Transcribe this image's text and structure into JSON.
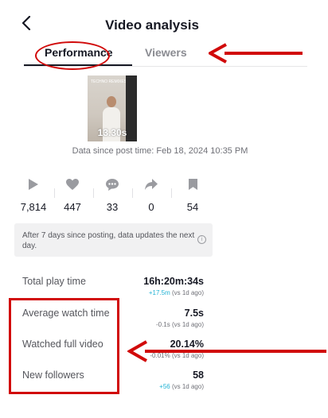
{
  "header": {
    "back_icon": "chevron-left-icon",
    "title": "Video analysis"
  },
  "tabs": [
    {
      "label": "Performance",
      "active": true
    },
    {
      "label": "Viewers",
      "active": false
    }
  ],
  "video": {
    "duration": "13.30s",
    "caption": "TECHNO REMIXES >"
  },
  "data_since": "Data since post time: Feb 18, 2024 10:35 PM",
  "stats": [
    {
      "icon": "play-icon",
      "value": "7,814"
    },
    {
      "icon": "heart-icon",
      "value": "447"
    },
    {
      "icon": "comment-icon",
      "value": "33"
    },
    {
      "icon": "share-icon",
      "value": "0"
    },
    {
      "icon": "bookmark-icon",
      "value": "54"
    }
  ],
  "notice": {
    "text": "After 7 days since posting, data updates the next day.",
    "icon": "info-icon"
  },
  "metrics": [
    {
      "label": "Total play time",
      "value": "16h:20m:34s",
      "delta_num": "+17.5m",
      "delta_rest": " (vs 1d ago)",
      "delta_positive": true
    },
    {
      "label": "Average watch time",
      "value": "7.5s",
      "delta_num": "-0.1s",
      "delta_rest": " (vs 1d ago)",
      "delta_positive": false
    },
    {
      "label": "Watched full video",
      "value": "20.14%",
      "delta_num": "-0.01%",
      "delta_rest": " (vs 1d ago)",
      "delta_positive": false
    },
    {
      "label": "New followers",
      "value": "58",
      "delta_num": "+56",
      "delta_rest": " (vs 1d ago)",
      "delta_positive": true
    }
  ],
  "colors": {
    "annotation": "#d10a0a",
    "positive_delta": "#20b2d4",
    "icon_gray": "#9a9ba0"
  }
}
